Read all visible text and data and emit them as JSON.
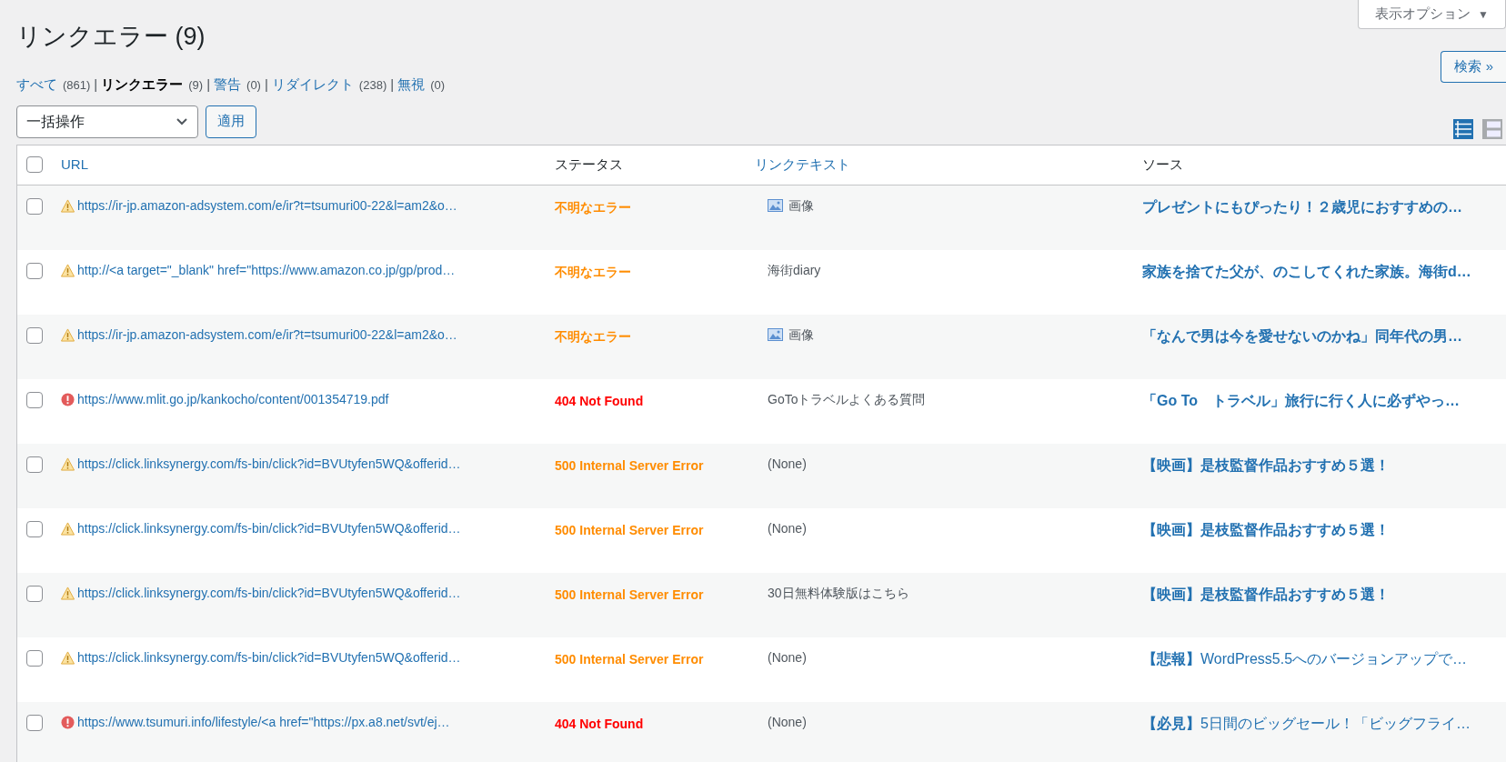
{
  "screen_options": {
    "label": "表示オプション",
    "caret": "▼"
  },
  "title": "リンクエラー (9)",
  "filters": [
    {
      "label": "すべて",
      "count": "(861)",
      "selected": false
    },
    {
      "separator": "|",
      "label": "リンクエラー",
      "count": "(9)",
      "selected": true
    },
    {
      "separator": "|",
      "label": "警告",
      "count": "(0)",
      "selected": false
    },
    {
      "separator": "|",
      "label": "リダイレクト",
      "count": "(238)",
      "selected": false
    },
    {
      "separator": "|",
      "label": "無視",
      "count": "(0)",
      "selected": false
    }
  ],
  "search_button": "検索 »",
  "bulk_action": {
    "value": "一括操作",
    "apply": "適用"
  },
  "view_modes": [
    {
      "kind": "compact",
      "selected": true
    },
    {
      "kind": "detailed",
      "selected": false
    }
  ],
  "table": {
    "select_all_checked": false,
    "columns": [
      {
        "label": "URL",
        "link": true
      },
      {
        "label": "ステータス",
        "link": false
      },
      {
        "label": "リンクテキスト",
        "link": true
      },
      {
        "label": "ソース",
        "link": false
      }
    ],
    "rows": [
      {
        "checked": false,
        "kind": "warning",
        "url": "https://ir-jp.amazon-adsystem.com/e/ir?t=tsumuri00-22&l=am2&o…",
        "status": "不明なエラー",
        "link_text": "画像",
        "image_link": true,
        "source": "プレゼントにもぴったり！２歳児におすすめの…",
        "source_bold": true
      },
      {
        "checked": false,
        "kind": "warning",
        "url": "http://<a target=\"_blank\" href=\"https://www.amazon.co.jp/gp/prod…",
        "status": "不明なエラー",
        "link_text": "海街diary",
        "image_link": false,
        "source": "家族を捨てた父が、のこしてくれた家族。海街d…",
        "source_bold": true
      },
      {
        "checked": false,
        "kind": "warning",
        "url": "https://ir-jp.amazon-adsystem.com/e/ir?t=tsumuri00-22&l=am2&o…",
        "status": "不明なエラー",
        "link_text": "画像",
        "image_link": true,
        "source": "「なんで男は今を愛せないのかね」同年代の男…",
        "source_bold": true
      },
      {
        "checked": false,
        "kind": "error",
        "url": "https://www.mlit.go.jp/kankocho/content/001354719.pdf",
        "status": "404 Not Found",
        "link_text": "GoToトラベルよくある質問",
        "image_link": false,
        "source": "「Go To　トラベル」旅行に行く人に必ずやっ…",
        "source_bold": true
      },
      {
        "checked": false,
        "kind": "warning",
        "url": "https://click.linksynergy.com/fs-bin/click?id=BVUtyfen5WQ&offerid…",
        "status": "500 Internal Server Error",
        "link_text": "(None)",
        "image_link": false,
        "source": "【映画】是枝監督作品おすすめ５選！",
        "source_bold": true
      },
      {
        "checked": false,
        "kind": "warning",
        "url": "https://click.linksynergy.com/fs-bin/click?id=BVUtyfen5WQ&offerid…",
        "status": "500 Internal Server Error",
        "link_text": "(None)",
        "image_link": false,
        "source": "【映画】是枝監督作品おすすめ５選！",
        "source_bold": true
      },
      {
        "checked": false,
        "kind": "warning",
        "url": "https://click.linksynergy.com/fs-bin/click?id=BVUtyfen5WQ&offerid…",
        "status": "500 Internal Server Error",
        "link_text": "30日無料体験版はこちら",
        "image_link": false,
        "source": "【映画】是枝監督作品おすすめ５選！",
        "source_bold": true
      },
      {
        "checked": false,
        "kind": "warning",
        "url": "https://click.linksynergy.com/fs-bin/click?id=BVUtyfen5WQ&offerid…",
        "status": "500 Internal Server Error",
        "link_text": "(None)",
        "image_link": false,
        "source": "**【悲報】**WordPress5.5へのバージョンアップで…",
        "source_bold": false
      },
      {
        "checked": false,
        "kind": "error",
        "url": "https://www.tsumuri.info/lifestyle/<a href=\"https://px.a8.net/svt/ej…",
        "status": "404 Not Found",
        "link_text": "(None)",
        "image_link": false,
        "source": "**【必見】**5日間のビッグセール！「ビッグフライ…",
        "source_bold": false
      }
    ]
  }
}
